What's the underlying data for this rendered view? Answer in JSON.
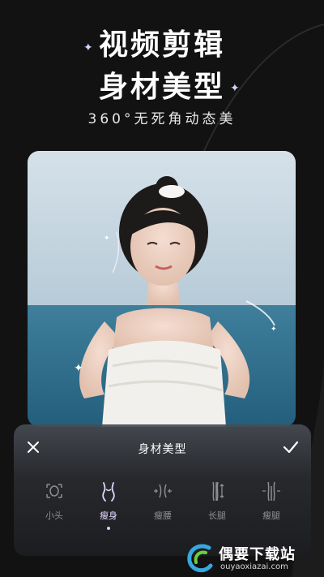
{
  "headline": {
    "line1": "视频剪辑",
    "line2": "身材美型",
    "subtitle": "360°无死角动态美"
  },
  "panel": {
    "title": "身材美型",
    "close_icon": "close-icon",
    "confirm_icon": "check-icon",
    "tools": [
      {
        "label": "小头",
        "icon": "small-head-icon",
        "active": false
      },
      {
        "label": "瘦身",
        "icon": "slim-body-icon",
        "active": true
      },
      {
        "label": "瘦腰",
        "icon": "slim-waist-icon",
        "active": false
      },
      {
        "label": "长腿",
        "icon": "long-legs-icon",
        "active": false
      },
      {
        "label": "瘦腿",
        "icon": "slim-legs-icon",
        "active": false
      }
    ]
  },
  "watermark": {
    "text": "偶要下载站",
    "url": "ouyaoxiazai.com"
  },
  "colors": {
    "background": "#121212",
    "accent": "#d8ccff"
  }
}
